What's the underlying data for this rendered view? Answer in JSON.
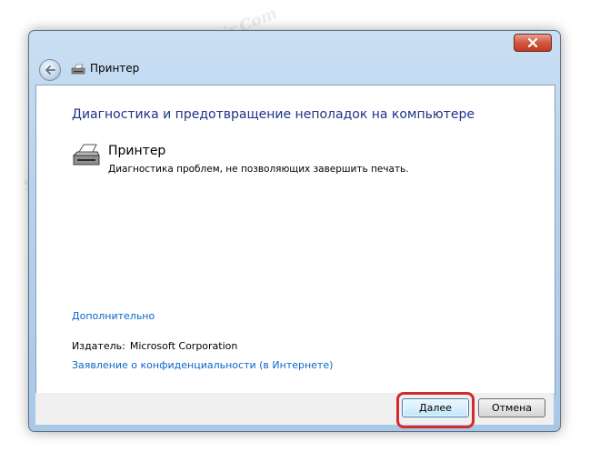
{
  "window": {
    "title": "Принтер",
    "close_icon": "close-icon",
    "back_icon": "back-arrow-icon",
    "title_icon": "printer-icon"
  },
  "content": {
    "heading": "Диагностика и предотвращение неполадок на компьютере",
    "item": {
      "icon": "printer-icon",
      "title": "Принтер",
      "description": "Диагностика проблем, не позволяющих завершить печать."
    },
    "advanced_link": "Дополнительно",
    "publisher_label": "Издатель:",
    "publisher_value": "Microsoft Corporation",
    "privacy_link": "Заявление о конфиденциальности (в Интернете)"
  },
  "buttons": {
    "next": "Далее",
    "cancel": "Отмена"
  },
  "watermark": "Soringpcrepair.Com",
  "colors": {
    "heading": "#1e3287",
    "link": "#0b66c9",
    "highlight": "#d62b2b"
  }
}
